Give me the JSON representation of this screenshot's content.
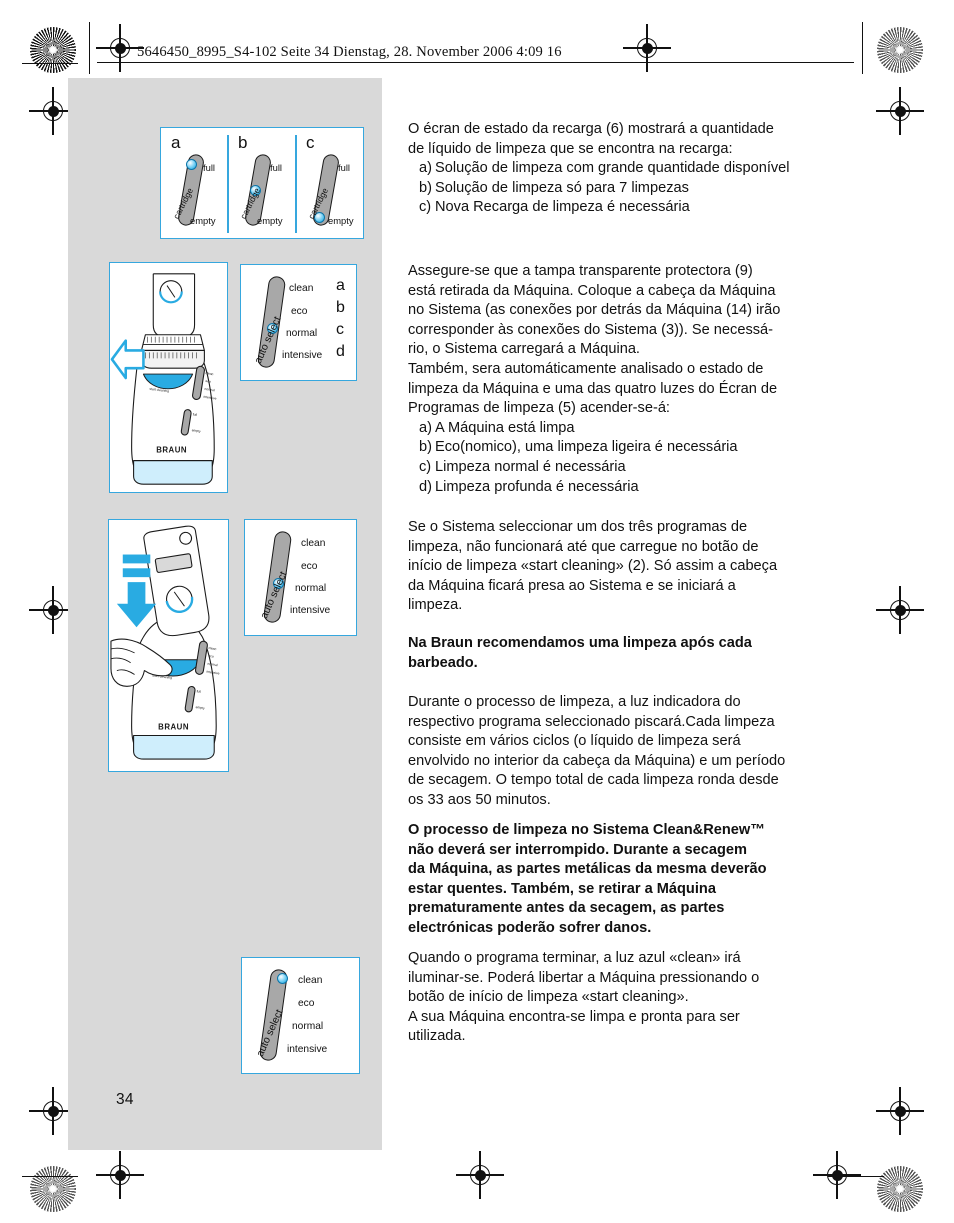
{
  "print_header": "5646450_8995_S4-102  Seite 34  Dienstag, 28. November 2006  4:09 16",
  "page_number": "34",
  "colors": {
    "figure_border": "#36a7de",
    "led_blue": "#0aa3e0",
    "panel_gray": "#d9d9d9",
    "accent_cyan": "#29abe2"
  },
  "figures": {
    "cartridge": {
      "name": "cartridge-level-indicator",
      "cells": [
        {
          "letter": "a",
          "top_label": "full",
          "bottom_label": "empty",
          "side_label": "cartridge",
          "led_position": "full"
        },
        {
          "letter": "b",
          "top_label": "full",
          "bottom_label": "empty",
          "side_label": "cartridge",
          "led_position": "middle"
        },
        {
          "letter": "c",
          "top_label": "full",
          "bottom_label": "empty",
          "side_label": "cartridge",
          "led_position": "empty"
        }
      ]
    },
    "auto_select_1": {
      "title": "auto select",
      "items": [
        "clean",
        "eco",
        "normal",
        "intensive"
      ],
      "letters": [
        "a",
        "b",
        "c",
        "d"
      ],
      "led_position": "normal"
    },
    "auto_select_2": {
      "title": "auto select",
      "items": [
        "clean",
        "eco",
        "normal",
        "intensive"
      ],
      "led_position": "normal"
    },
    "auto_select_3": {
      "title": "auto select",
      "items": [
        "clean",
        "eco",
        "normal",
        "intensive"
      ],
      "led_position": "clean"
    },
    "shaver_insert": {
      "name": "insert-shaver-into-station",
      "brand": "BRAUN",
      "arrow": "hollow-left-arrow"
    },
    "shaver_press": {
      "name": "press-start-cleaning-button",
      "brand": "BRAUN",
      "arrow": "solid-down-arrow"
    }
  },
  "body": {
    "p1": {
      "lines": [
        "O écran de estado da recarga (6) mostrará a quantidade",
        "de líquido de limpeza que se encontra na recarga:"
      ],
      "items": [
        {
          "marker": "a)",
          "text": "Solução de limpeza com grande quantidade disponível"
        },
        {
          "marker": "b)",
          "text": "Solução de limpeza só para 7 limpezas"
        },
        {
          "marker": "c)",
          "text": "Nova Recarga de limpeza é necessária"
        }
      ]
    },
    "p2": {
      "lines": [
        "Assegure-se que a tampa transparente protectora (9)",
        "está retirada da Máquina. Coloque a cabeça da Máquina",
        "no Sistema (as conexões por detrás da Máquina (14) irão",
        "corresponder às conexões do Sistema (3)). Se necessá-",
        "rio, o Sistema carregará a Máquina.",
        "Também, sera automáticamente analisado o estado de",
        "limpeza da Máquina e uma das quatro luzes do Écran de",
        "Programas de limpeza (5) acender-se-á:"
      ],
      "items": [
        {
          "marker": "a)",
          "text": "A Máquina está limpa"
        },
        {
          "marker": "b)",
          "text": "Eco(nomico), uma limpeza ligeira é necessária"
        },
        {
          "marker": "c)",
          "text": "Limpeza normal é necessária"
        },
        {
          "marker": "d)",
          "text": "Limpeza profunda é necessária"
        }
      ]
    },
    "p3": {
      "lines": [
        "Se o Sistema seleccionar um dos três programas de",
        "limpeza, não funcionará até que carregue no botão de",
        "início de limpeza «start cleaning» (2). Só assim a cabeça",
        "da Máquina ficará presa ao Sistema e se iniciará a",
        "limpeza."
      ]
    },
    "p4_bold": {
      "lines": [
        "Na Braun recomendamos uma limpeza após cada",
        "barbeado."
      ]
    },
    "p5": {
      "lines": [
        "Durante o processo de limpeza, a luz indicadora do",
        "respectivo programa seleccionado piscará.Cada limpeza",
        "consiste em vários ciclos (o líquido de limpeza será",
        "envolvido no interior da cabeça da Máquina) e um período",
        "de secagem. O tempo total de cada limpeza ronda desde",
        "os 33 aos 50 minutos."
      ]
    },
    "p6_bold": {
      "lines": [
        "O processo de limpeza no Sistema Clean&Renew™",
        "não deverá ser interrompido. Durante a secagem",
        "da Máquina, as partes metálicas da mesma deverão",
        "estar quentes. Também, se retirar a Máquina",
        "prematuramente antes da secagem, as partes",
        "electrónicas poderão sofrer danos."
      ]
    },
    "p7": {
      "lines": [
        "Quando o programa terminar, a luz azul «clean» irá",
        "iluminar-se. Poderá libertar a Máquina pressionando o",
        "botão de início de limpeza «start cleaning».",
        "A sua Máquina encontra-se limpa e pronta para ser",
        "utilizada."
      ]
    }
  }
}
